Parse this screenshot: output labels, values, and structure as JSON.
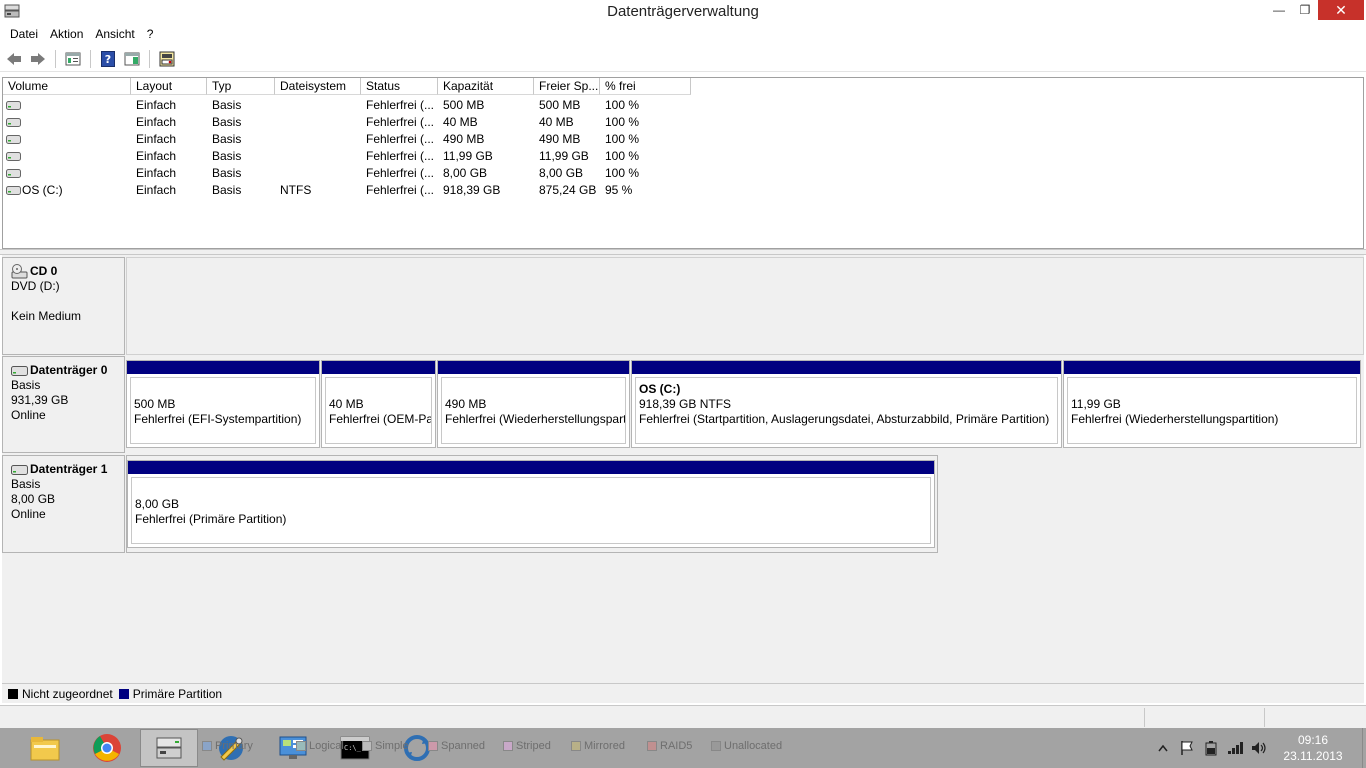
{
  "window": {
    "title": "Datenträgerverwaltung",
    "close_glyph": "✕",
    "maximize_glyph": "❐",
    "minimize_glyph": "—"
  },
  "menu": [
    {
      "label": "Datei"
    },
    {
      "label": "Aktion"
    },
    {
      "label": "Ansicht"
    },
    {
      "label": "?"
    }
  ],
  "toolbar": {
    "icons": [
      "back-arrow-icon",
      "forward-arrow-icon",
      "properties-icon",
      "help-icon",
      "console-view-icon",
      "disk-settings-icon"
    ]
  },
  "volume_table": {
    "columns": [
      "Volume",
      "Layout",
      "Typ",
      "Dateisystem",
      "Status",
      "Kapazität",
      "Freier Sp...",
      "% frei"
    ],
    "rows": [
      {
        "volume": "",
        "layout": "Einfach",
        "typ": "Basis",
        "fs": "",
        "status": "Fehlerfrei (...",
        "kap": "500 MB",
        "frei": "500 MB",
        "pct": "100 %"
      },
      {
        "volume": "",
        "layout": "Einfach",
        "typ": "Basis",
        "fs": "",
        "status": "Fehlerfrei (...",
        "kap": "40 MB",
        "frei": "40 MB",
        "pct": "100 %"
      },
      {
        "volume": "",
        "layout": "Einfach",
        "typ": "Basis",
        "fs": "",
        "status": "Fehlerfrei (...",
        "kap": "490 MB",
        "frei": "490 MB",
        "pct": "100 %"
      },
      {
        "volume": "",
        "layout": "Einfach",
        "typ": "Basis",
        "fs": "",
        "status": "Fehlerfrei (...",
        "kap": "11,99 GB",
        "frei": "11,99 GB",
        "pct": "100 %"
      },
      {
        "volume": "",
        "layout": "Einfach",
        "typ": "Basis",
        "fs": "",
        "status": "Fehlerfrei (...",
        "kap": "8,00 GB",
        "frei": "8,00 GB",
        "pct": "100 %"
      },
      {
        "volume": "OS (C:)",
        "layout": "Einfach",
        "typ": "Basis",
        "fs": "NTFS",
        "status": "Fehlerfrei (...",
        "kap": "918,39 GB",
        "frei": "875,24 GB",
        "pct": "95 %"
      }
    ]
  },
  "disks": {
    "cd0": {
      "name": "CD 0",
      "line1": "DVD (D:)",
      "line2": "Kein Medium"
    },
    "disk0": {
      "name": "Datenträger 0",
      "type": "Basis",
      "size": "931,39 GB",
      "state": "Online",
      "partitions": [
        {
          "name": "",
          "size": "500 MB",
          "status": "Fehlerfrei (EFI-Systempartition)"
        },
        {
          "name": "",
          "size": "40 MB",
          "status": "Fehlerfrei (OEM-Pa"
        },
        {
          "name": "",
          "size": "490 MB",
          "status": "Fehlerfrei (Wiederherstellungspart"
        },
        {
          "name": "OS  (C:)",
          "size": "918,39 GB NTFS",
          "status": "Fehlerfrei (Startpartition, Auslagerungsdatei, Absturzabbild, Primäre Partition)"
        },
        {
          "name": "",
          "size": "11,99 GB",
          "status": "Fehlerfrei (Wiederherstellungspartition)"
        }
      ]
    },
    "disk1": {
      "name": "Datenträger 1",
      "type": "Basis",
      "size": "8,00 GB",
      "state": "Online",
      "partitions": [
        {
          "name": "",
          "size": "8,00 GB",
          "status": "Fehlerfrei (Primäre Partition)"
        }
      ]
    }
  },
  "legend": [
    {
      "label": "Nicht zugeordnet",
      "color": "#000000"
    },
    {
      "label": "Primäre Partition",
      "color": "#000080"
    }
  ],
  "colors": {
    "primary_partition": "#000080",
    "close_button": "#c7312a",
    "taskbar": "#a3a3a3"
  },
  "taskbar": {
    "apps": [
      "file-explorer-icon",
      "chrome-icon",
      "disk-management-icon",
      "tools-icon",
      "control-panel-icon",
      "command-prompt-icon",
      "sync-icon"
    ],
    "ghost_labels": [
      "Primary",
      "Logical",
      "Simple",
      "Spanned",
      "Striped",
      "Mirrored",
      "RAID5",
      "Unallocated"
    ],
    "clock_time": "09:16",
    "clock_date": "23.11.2013"
  }
}
